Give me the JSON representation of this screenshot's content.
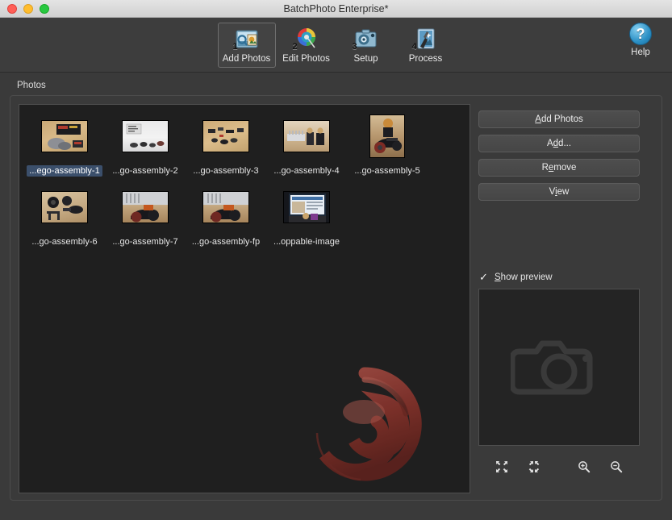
{
  "window": {
    "title": "BatchPhoto Enterprise*",
    "traffic_lights": [
      "close-button",
      "minimize-button",
      "maximize-button"
    ]
  },
  "toolbar": {
    "items": [
      {
        "label": "Add Photos",
        "badge": "1",
        "icon": "add-photos-icon",
        "selected": true
      },
      {
        "label": "Edit Photos",
        "badge": "2",
        "icon": "edit-photos-icon",
        "selected": false
      },
      {
        "label": "Setup",
        "badge": "3",
        "icon": "setup-icon",
        "selected": false
      },
      {
        "label": "Process",
        "badge": "4",
        "icon": "process-icon",
        "selected": false
      }
    ],
    "help": {
      "label": "Help",
      "symbol": "?",
      "icon": "help-icon"
    }
  },
  "main": {
    "group_label": "Photos",
    "photos": [
      {
        "label": "...ego-assembly-1",
        "selected": true,
        "orientation": "landscape"
      },
      {
        "label": "...go-assembly-2",
        "selected": false,
        "orientation": "landscape"
      },
      {
        "label": "...go-assembly-3",
        "selected": false,
        "orientation": "landscape"
      },
      {
        "label": "...go-assembly-4",
        "selected": false,
        "orientation": "landscape"
      },
      {
        "label": "...go-assembly-5",
        "selected": false,
        "orientation": "portrait"
      },
      {
        "label": "...go-assembly-6",
        "selected": false,
        "orientation": "landscape"
      },
      {
        "label": "...go-assembly-7",
        "selected": false,
        "orientation": "landscape"
      },
      {
        "label": "...go-assembly-fp",
        "selected": false,
        "orientation": "landscape"
      },
      {
        "label": "...oppable-image",
        "selected": false,
        "orientation": "landscape"
      }
    ],
    "watermark": "batchphoto-swirl-logo"
  },
  "side_panel": {
    "buttons": [
      {
        "label": "Add Photos",
        "mnemonic_index": 0,
        "name": "add-photos-button"
      },
      {
        "label": "Add...",
        "mnemonic_index": 2,
        "name": "add-button"
      },
      {
        "label": "Remove",
        "mnemonic_index": 1,
        "name": "remove-button"
      },
      {
        "label": "View",
        "mnemonic_index": 2,
        "name": "view-button"
      }
    ],
    "show_preview": {
      "label": "Show preview",
      "checked": true,
      "check_mark": "✓",
      "mnemonic_index": 0
    },
    "preview": {
      "placeholder_icon": "camera-placeholder-icon"
    },
    "preview_tools": [
      {
        "name": "fit-to-window-icon",
        "title": "Fit to window"
      },
      {
        "name": "actual-size-icon",
        "title": "Actual size"
      },
      {
        "name": "zoom-in-icon",
        "title": "Zoom in"
      },
      {
        "name": "zoom-out-icon",
        "title": "Zoom out"
      }
    ]
  },
  "colors": {
    "window_chrome": "#d6d6d6",
    "app_background": "#3a3a3a",
    "toolbar_background": "#3d3d3d",
    "list_background": "#1f1f1f",
    "selection_blue": "#3b4f6b",
    "help_blue": "#2a8fc4",
    "watermark_red": "#8c3a34",
    "text_primary": "#e8e8e8"
  }
}
